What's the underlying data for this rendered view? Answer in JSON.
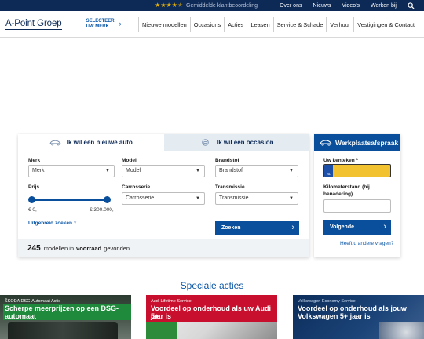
{
  "topbar": {
    "rating_text": "Gemiddelde klantbeoordeling",
    "links": [
      "Over ons",
      "Nieuws",
      "Video's",
      "Werken bij"
    ]
  },
  "header": {
    "logo": "A-Point Groep",
    "merk_select_line1": "SELECTEER",
    "merk_select_line2": "UW MERK",
    "nav": [
      "Nieuwe modellen",
      "Occasions",
      "Acties",
      "Leasen",
      "Service & Schade",
      "Verhuur",
      "Vestigingen & Contact"
    ]
  },
  "search": {
    "tab_new": "Ik wil een nieuwe auto",
    "tab_occasion": "Ik wil een occasion",
    "merk_label": "Merk",
    "merk_value": "Merk",
    "model_label": "Model",
    "model_value": "Model",
    "brandstof_label": "Brandstof",
    "brandstof_value": "Brandstof",
    "prijs_label": "Prijs",
    "price_min": "€ 0,-",
    "price_max": "€ 300.000,-",
    "carrosserie_label": "Carrosserie",
    "carrosserie_value": "Carrosserie",
    "transmissie_label": "Transmissie",
    "transmissie_value": "Transmissie",
    "advanced_link": "Uitgebreid zoeken",
    "search_button": "Zoeken",
    "result_count": "245",
    "result_text_1": "modellen in",
    "result_bold": "voorraad",
    "result_text_2": "gevonden"
  },
  "werkplaats": {
    "title": "Werkplaatsafspraak",
    "kenteken_label": "Uw kenteken *",
    "plate_country": "NL",
    "km_label_1": "Kilometerstand (bij",
    "km_label_2": "benadering)",
    "next_button": "Volgende",
    "help_link": "Heeft u andere vragen?"
  },
  "acties": {
    "title": "Speciale acties",
    "promos": [
      {
        "small": "ŠKODA DSG-Automaat Actie",
        "big_1": "Scherpe meerprijzen op een DSG-automaat",
        "big_2": ""
      },
      {
        "small": "Audi Lifetime Service",
        "big_1": "Voordeel op onderhoud als uw Audi 5+",
        "big_2": "jaar is"
      },
      {
        "small": "Volkswagen Economy Service",
        "big_1": "Voordeel op onderhoud als jouw",
        "big_2": "Volkswagen 5+ jaar is"
      }
    ]
  },
  "colors": {
    "navy": "#0d2a57",
    "blue": "#0a4f9b",
    "link": "#0a56a6",
    "star": "#f2b705",
    "plate": "#f2c230",
    "skoda_green": "#1f8a3c",
    "audi_red": "#c8102e",
    "vw_navy": "#0b2d5b"
  }
}
